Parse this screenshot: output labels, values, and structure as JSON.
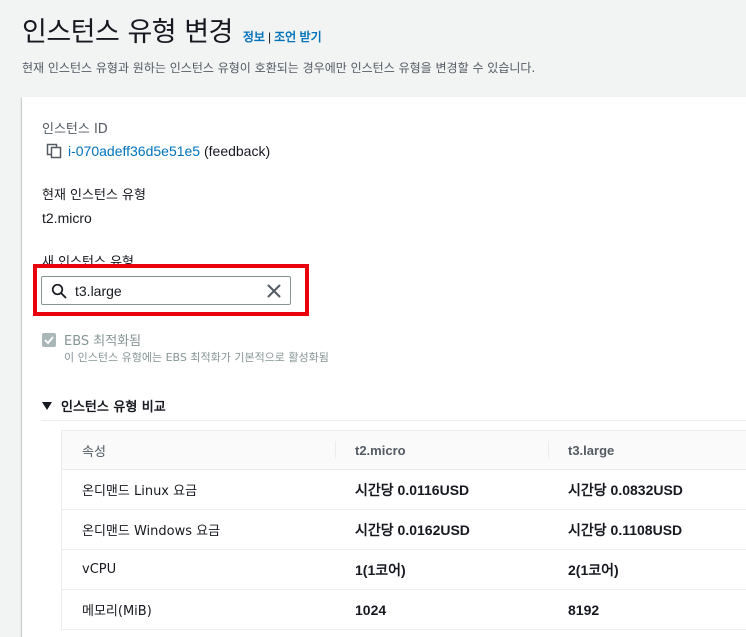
{
  "header": {
    "title": "인스턴스 유형 변경",
    "info_link": "정보",
    "separator": "|",
    "advice_link": "조언 받기",
    "subtitle": "현재 인스턴스 유형과 원하는 인스턴스 유형이 호환되는 경우에만 인스턴스 유형을 변경할 수 있습니다."
  },
  "form": {
    "instance_id_label": "인스턴스 ID",
    "instance_id": "i-070adeff36d5e51e5",
    "instance_suffix": "(feedback)",
    "current_type_label": "현재 인스턴스 유형",
    "current_type": "t2.micro",
    "new_type_label": "새 인스턴스 유형",
    "new_type_value": "t3.large",
    "ebs_label": "EBS 최적화됨",
    "ebs_description": "이 인스턴스 유형에는 EBS 최적화가 기본적으로 활성화됨",
    "ebs_checked": true
  },
  "comparison": {
    "title": "인스턴스 유형 비교",
    "expanded": true,
    "columns": [
      "속성",
      "t2.micro",
      "t3.large"
    ],
    "rows": [
      [
        "온디맨드 Linux 요금",
        "시간당 0.0116USD",
        "시간당 0.0832USD"
      ],
      [
        "온디맨드 Windows 요금",
        "시간당 0.0162USD",
        "시간당 0.1108USD"
      ],
      [
        "vCPU",
        "1(1코어)",
        "2(1코어)"
      ],
      [
        "메모리(MiB)",
        "1024",
        "8192"
      ]
    ]
  },
  "colors": {
    "link": "#0073bb",
    "highlight": "#e8000b",
    "background": "#f2f3f3"
  },
  "icons": [
    "copy-icon",
    "search-icon",
    "clear-icon",
    "caret-down-icon",
    "checkmark-icon"
  ]
}
